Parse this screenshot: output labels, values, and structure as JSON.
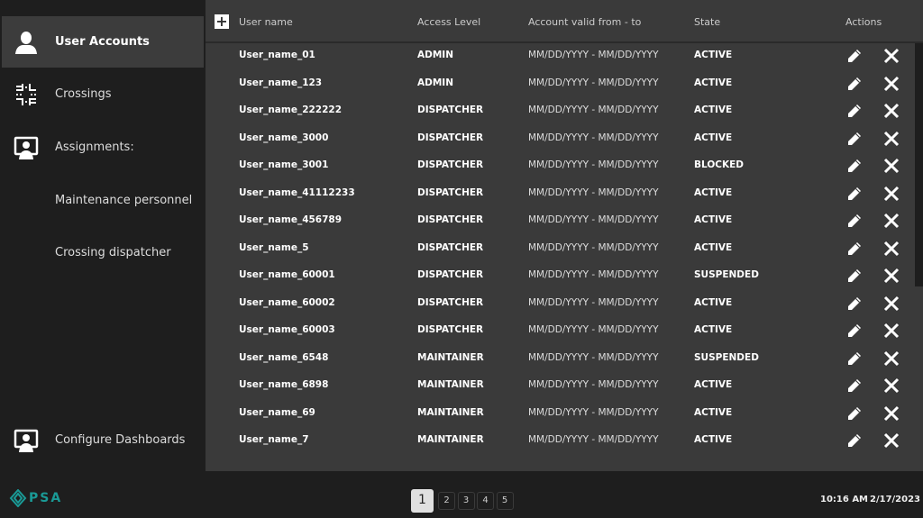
{
  "sidebar": {
    "items": [
      {
        "label": "User Accounts",
        "icon": "user-icon",
        "active": true
      },
      {
        "label": "Crossings",
        "icon": "crossing-icon"
      },
      {
        "label": "Assignments:",
        "icon": "monitor-user-icon"
      },
      {
        "label": "Maintenance personnel"
      },
      {
        "label": "Crossing dispatcher"
      },
      {
        "label": "Configure Dashboards",
        "icon": "monitor-user-icon"
      }
    ]
  },
  "table": {
    "headers": {
      "username": "User name",
      "access": "Access Level",
      "valid": "Account valid from - to",
      "state": "State",
      "actions": "Actions"
    },
    "add_label": "+",
    "rows": [
      {
        "user": "User_name_01",
        "access": "ADMIN",
        "valid": "MM/DD/YYYY - MM/DD/YYYY",
        "state": "ACTIVE"
      },
      {
        "user": "User_name_123",
        "access": "ADMIN",
        "valid": "MM/DD/YYYY - MM/DD/YYYY",
        "state": "ACTIVE"
      },
      {
        "user": "User_name_222222",
        "access": "DISPATCHER",
        "valid": "MM/DD/YYYY - MM/DD/YYYY",
        "state": "ACTIVE"
      },
      {
        "user": "User_name_3000",
        "access": "DISPATCHER",
        "valid": "MM/DD/YYYY - MM/DD/YYYY",
        "state": "ACTIVE"
      },
      {
        "user": "User_name_3001",
        "access": "DISPATCHER",
        "valid": "MM/DD/YYYY - MM/DD/YYYY",
        "state": "BLOCKED"
      },
      {
        "user": "User_name_41112233",
        "access": "DISPATCHER",
        "valid": "MM/DD/YYYY - MM/DD/YYYY",
        "state": "ACTIVE"
      },
      {
        "user": "User_name_456789",
        "access": "DISPATCHER",
        "valid": "MM/DD/YYYY - MM/DD/YYYY",
        "state": "ACTIVE"
      },
      {
        "user": "User_name_5",
        "access": "DISPATCHER",
        "valid": "MM/DD/YYYY - MM/DD/YYYY",
        "state": "ACTIVE"
      },
      {
        "user": "User_name_60001",
        "access": "DISPATCHER",
        "valid": "MM/DD/YYYY - MM/DD/YYYY",
        "state": "SUSPENDED"
      },
      {
        "user": "User_name_60002",
        "access": "DISPATCHER",
        "valid": "MM/DD/YYYY - MM/DD/YYYY",
        "state": "ACTIVE"
      },
      {
        "user": "User_name_60003",
        "access": "DISPATCHER",
        "valid": "MM/DD/YYYY - MM/DD/YYYY",
        "state": "ACTIVE"
      },
      {
        "user": "User_name_6548",
        "access": "MAINTAINER",
        "valid": "MM/DD/YYYY - MM/DD/YYYY",
        "state": "SUSPENDED"
      },
      {
        "user": "User_name_6898",
        "access": "MAINTAINER",
        "valid": "MM/DD/YYYY - MM/DD/YYYY",
        "state": "ACTIVE"
      },
      {
        "user": "User_name_69",
        "access": "MAINTAINER",
        "valid": "MM/DD/YYYY - MM/DD/YYYY",
        "state": "ACTIVE"
      },
      {
        "user": "User_name_7",
        "access": "MAINTAINER",
        "valid": "MM/DD/YYYY - MM/DD/YYYY",
        "state": "ACTIVE"
      }
    ]
  },
  "footer": {
    "logo": "PSA",
    "logo_color": "#1a9a96",
    "pages": [
      "1",
      "2",
      "3",
      "4",
      "5"
    ],
    "current_page": "1",
    "time": "10:16 AM",
    "date": "2/17/2023"
  }
}
